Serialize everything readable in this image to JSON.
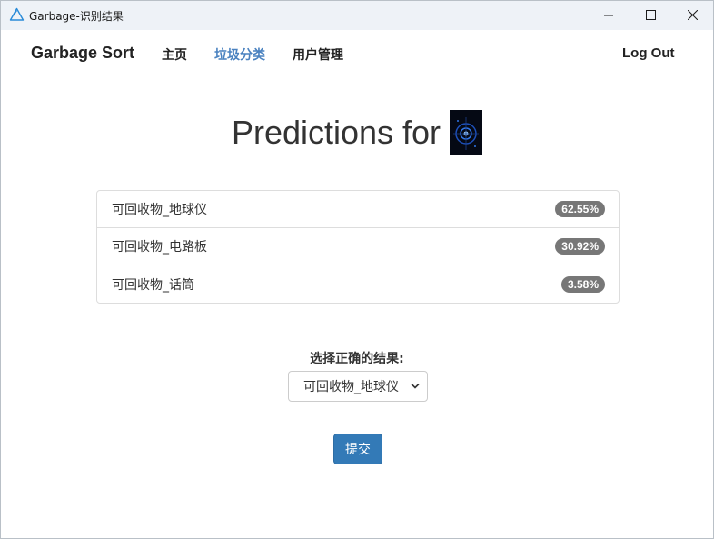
{
  "window": {
    "title": "Garbage-识别结果",
    "controls": [
      "minimize-icon",
      "maximize-icon",
      "close-icon"
    ]
  },
  "navbar": {
    "brand": "Garbage Sort",
    "links": [
      {
        "label": "主页",
        "active": false
      },
      {
        "label": "垃圾分类",
        "active": true
      },
      {
        "label": "用户管理",
        "active": false
      }
    ],
    "logout": "Log Out"
  },
  "heading": "Predictions for",
  "predictions": [
    {
      "label": "可回收物_地球仪",
      "probability": "62.55%"
    },
    {
      "label": "可回收物_电路板",
      "probability": "30.92%"
    },
    {
      "label": "可回收物_话筒",
      "probability": "3.58%"
    }
  ],
  "form": {
    "label": "选择正确的结果:",
    "selected": "可回收物_地球仪",
    "submit": "提交"
  },
  "colors": {
    "accent": "#337ab7",
    "active_link": "#4a82c0",
    "badge": "#777777"
  }
}
